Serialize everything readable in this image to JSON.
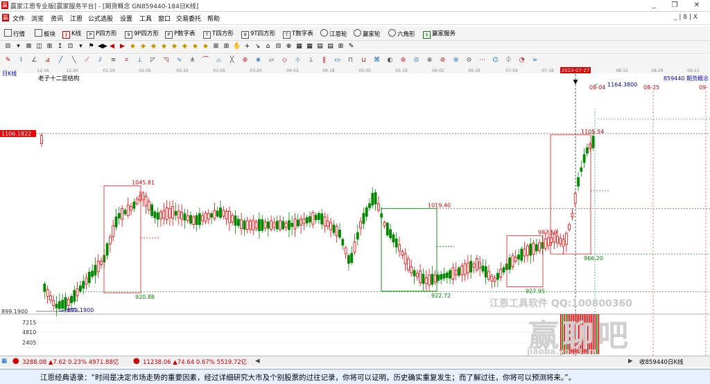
{
  "window": {
    "title": "赢家江恩专业版[赢家服务平台] - [期货概念  GN859440-184日K线]",
    "min": "_",
    "max": "❐",
    "close": "✕"
  },
  "menu": {
    "items": [
      "文件",
      "浏览",
      "资讯",
      "江恩",
      "公式选股",
      "设置",
      "工具",
      "窗口",
      "交易委托",
      "帮助"
    ],
    "mdi": "_ | 8 | X"
  },
  "toolbar": {
    "items": [
      "行情",
      "板块",
      "K线",
      "P四方形",
      "9P四方形",
      "P数字表",
      "T四方形",
      "9T四方形",
      "T数字表",
      "江恩轮",
      "赢家轮",
      "六角形",
      "赢家服务"
    ]
  },
  "chart_data": {
    "type": "candlestick",
    "period": "日K线",
    "study_title": "老子十二宫结构",
    "code_label": "859440 期货概念",
    "x_dates": [
      "12-16",
      "12-30",
      "01-16",
      "02-06",
      "02-20",
      "03-06",
      "03-20",
      "04-03",
      "04-18",
      "05-05",
      "05-19",
      "06-02",
      "06-16",
      "07-04",
      "07-18",
      "2023-07-27",
      "08-15",
      "08-29",
      "09-12"
    ],
    "highlight_date": "2023-07-27",
    "price_labels": [
      "1106.1822",
      "899.1900"
    ],
    "price_range": [
      870,
      1200
    ],
    "annotations": {
      "high1": "1045.81",
      "low1": "920.88",
      "high2": "1019.40",
      "low2": "922.72",
      "high3": "987.59",
      "low3": "927.95",
      "high4": "1105.54",
      "low4": "966.20",
      "bottom": "899.1900",
      "target": "1164.3800",
      "proj_dates": [
        "08-04",
        "08-25",
        "09-"
      ]
    },
    "volume_labels": [
      "7215",
      "4810",
      "2405"
    ]
  },
  "watermark": {
    "qq": "江恩工具软件  QQ:100800360",
    "big": "赢聊吧",
    "url": "jiaoba.yo..3..m"
  },
  "status": {
    "sh": "3288.08 ▲7.62 0.23% 4971.88亿",
    "sz": "11238.06 ▲74.64 0.67% 5519.72亿",
    "right": "收859440日K线"
  },
  "quote": "江恩经典语录：“时间是决定市场走势的重要因素，经过详细研究大市及个别股票的过往记录，你将可以证明，历史确实重复发生；而了解过往，你将可以预测将来。”。"
}
